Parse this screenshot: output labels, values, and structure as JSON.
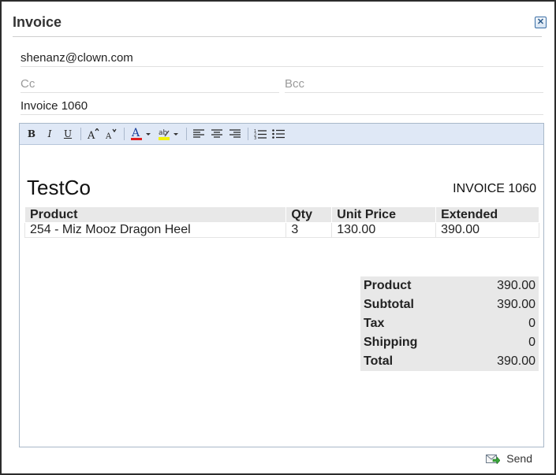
{
  "dialog": {
    "title": "Invoice"
  },
  "fields": {
    "to": "shenanz@clown.com",
    "cc_placeholder": "Cc",
    "bcc_placeholder": "Bcc",
    "subject": "Invoice 1060"
  },
  "toolbar": {
    "buttons": [
      "bold-icon",
      "italic-icon",
      "underline-icon",
      "grow-font-icon",
      "shrink-font-icon",
      "font-color-icon",
      "highlight-icon",
      "align-left-icon",
      "align-center-icon",
      "align-right-icon",
      "ordered-list-icon",
      "unordered-list-icon"
    ],
    "bold": "B",
    "italic": "I",
    "underline": "U",
    "font_color_accent": "#e02020",
    "highlight_accent": "#f2f20a"
  },
  "invoice": {
    "company": "TestCo",
    "number_label": "INVOICE 1060",
    "columns": [
      "Product",
      "Qty",
      "Unit Price",
      "Extended"
    ],
    "rows": [
      [
        "254 - Miz Mooz Dragon Heel",
        "3",
        "130.00",
        "390.00"
      ]
    ],
    "totals": [
      {
        "label": "Product",
        "value": "390.00"
      },
      {
        "label": "Subtotal",
        "value": "390.00"
      },
      {
        "label": "Tax",
        "value": "0"
      },
      {
        "label": "Shipping",
        "value": "0"
      },
      {
        "label": "Total",
        "value": "390.00"
      }
    ]
  },
  "footer": {
    "send_label": "Send"
  }
}
